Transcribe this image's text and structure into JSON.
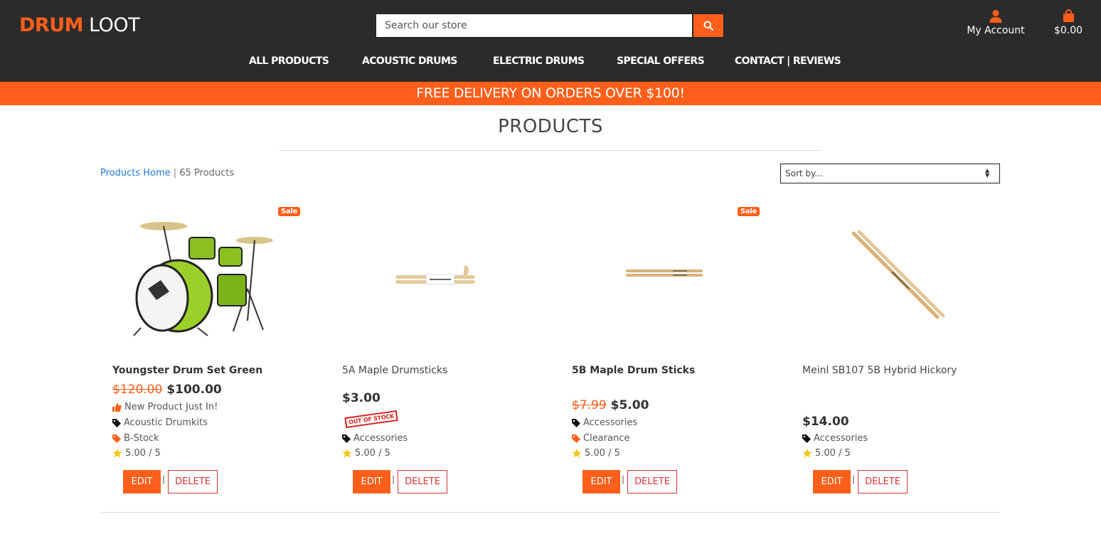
{
  "header": {
    "logo_part1": "DRUM",
    "logo_part2": "LOOT",
    "search_placeholder": "Search our store",
    "account_label": "My Account",
    "cart_total": "$0.00",
    "nav": [
      "ALL PRODUCTS",
      "ACOUSTIC DRUMS",
      "ELECTRIC DRUMS",
      "SPECIAL OFFERS",
      "CONTACT | REVIEWS"
    ]
  },
  "banner": "FREE DELIVERY ON ORDERS OVER $100!",
  "page": {
    "title": "PRODUCTS",
    "breadcrumb_link": "Products Home",
    "breadcrumb_sep": " | ",
    "product_count": "65 Products",
    "sort_label": "Sort by..."
  },
  "colors": {
    "accent": "#ff5f1a",
    "header_bg": "#2b2b2b",
    "link": "#1f7adc",
    "star": "#f5c518"
  },
  "products": [
    {
      "name": "Youngster Drum Set Green",
      "sale_badge": "Sale",
      "old_price": "$120.00",
      "price": "$100.00",
      "highlight": "New Product Just In!",
      "category": "Acoustic Drumkits",
      "tag": "B-Stock",
      "rating": "5.00 / 5",
      "edit": "EDIT",
      "delete": "DELETE"
    },
    {
      "name": "5A Maple Drumsticks",
      "price": "$3.00",
      "stock_stamp": "OUT OF STOCK",
      "category": "Accessories",
      "rating": "5.00 / 5",
      "edit": "EDIT",
      "delete": "DELETE"
    },
    {
      "name": "5B Maple Drum Sticks",
      "sale_badge": "Sale",
      "old_price": "$7.99",
      "price": "$5.00",
      "category": "Accessories",
      "tag": "Clearance",
      "rating": "5.00 / 5",
      "edit": "EDIT",
      "delete": "DELETE"
    },
    {
      "name": "Meinl SB107 5B Hybrid Hickory",
      "price": "$14.00",
      "category": "Accessories",
      "rating": "5.00 / 5",
      "edit": "EDIT",
      "delete": "DELETE"
    }
  ]
}
